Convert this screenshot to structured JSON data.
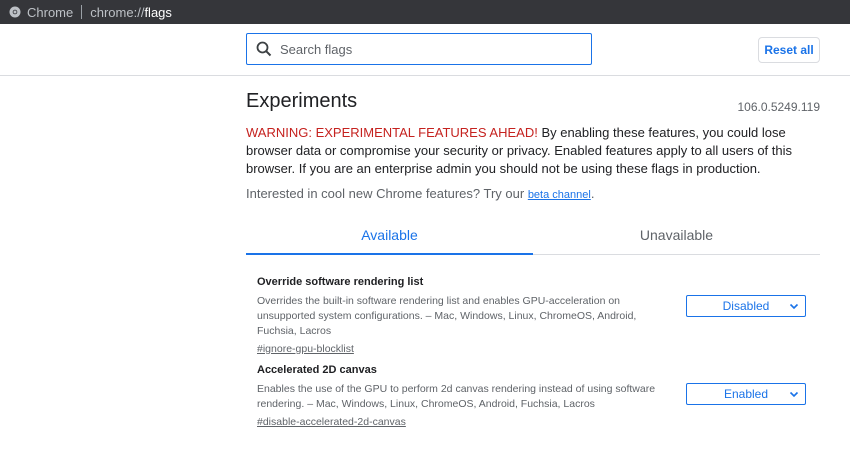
{
  "omnibox": {
    "site_name": "Chrome",
    "url_scheme": "chrome://",
    "url_host": "flags"
  },
  "header": {
    "search": {
      "placeholder": "Search flags",
      "value": ""
    },
    "reset_all_label": "Reset all"
  },
  "main": {
    "title": "Experiments",
    "version": "106.0.5249.119",
    "warning_lead": "WARNING: EXPERIMENTAL FEATURES AHEAD!",
    "warning_body": " By enabling these features, you could lose browser data or compromise your security or privacy. Enabled features apply to all users of this browser. If you are an enterprise admin you should not be using these flags in production.",
    "blurb_text": "Interested in cool new Chrome features? Try our ",
    "blurb_link": "beta channel",
    "blurb_end": ".",
    "tabs": [
      {
        "label": "Available",
        "active": true
      },
      {
        "label": "Unavailable",
        "active": false
      }
    ],
    "flags": [
      {
        "title": "Override software rendering list",
        "description": "Overrides the built-in software rendering list and enables GPU-acceleration on unsupported system configurations. – Mac, Windows, Linux, ChromeOS, Android, Fuchsia, Lacros",
        "link": "#ignore-gpu-blocklist",
        "state": "Disabled"
      },
      {
        "title": "Accelerated 2D canvas",
        "description": "Enables the use of the GPU to perform 2d canvas rendering instead of using software rendering. – Mac, Windows, Linux, ChromeOS, Android, Fuchsia, Lacros",
        "link": "#disable-accelerated-2d-canvas",
        "state": "Enabled"
      }
    ]
  },
  "colors": {
    "accent": "#1a73e8",
    "warning": "#c5221f",
    "toolbar": "#35363a"
  }
}
